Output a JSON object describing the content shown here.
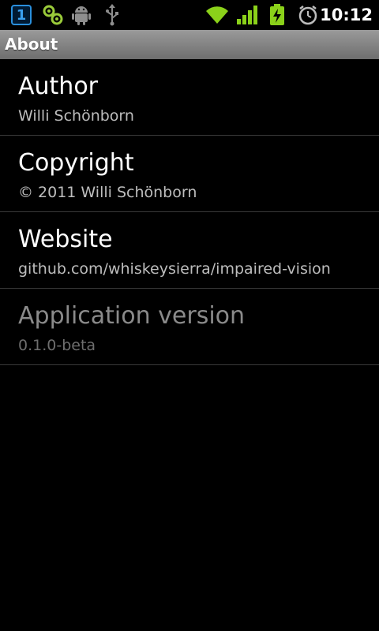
{
  "statusbar": {
    "calendar_day": "1",
    "time": "10:12",
    "colors": {
      "calendar": "#2a8fdc",
      "signal": "#8bd11a",
      "battery": "#8bd11a"
    }
  },
  "header": {
    "title": "About"
  },
  "prefs": [
    {
      "title": "Author",
      "summary": "Willi Schönborn"
    },
    {
      "title": "Copyright",
      "summary": "© 2011 Willi Schönborn"
    },
    {
      "title": "Website",
      "summary": "github.com/whiskeysierra/impaired-vision"
    },
    {
      "title": "Application version",
      "summary": "0.1.0-beta"
    }
  ]
}
